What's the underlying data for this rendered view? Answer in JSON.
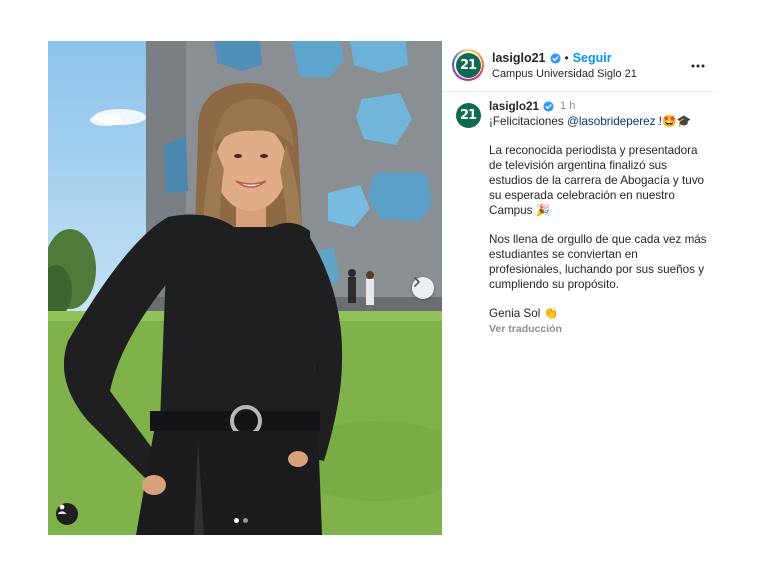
{
  "post": {
    "account": {
      "username": "lasiglo21",
      "logo_text": "21",
      "location": "Campus Universidad Siglo 21",
      "follow_label": "Seguir",
      "separator": "•"
    },
    "caption": {
      "username": "lasiglo21",
      "time": "1 h",
      "line1_prefix": "¡Felicitaciones ",
      "mention": "@lasobrideperez",
      "line1_suffix": " !🤩🎓",
      "paragraph1": "La reconocida periodista y presentadora de televisión argentina finalizó sus estudios de la carrera de Abogacía y tuvo su esperada celebración en nuestro Campus 🎉",
      "paragraph2": "Nos llena de orgullo de que cada vez más estudiantes se conviertan en profesionales, luchando por sus sueños y cumpliendo su propósito.",
      "signoff": "Genia Sol 👏",
      "translate_label": "Ver traducción"
    },
    "carousel": {
      "current": 1,
      "total": 2
    },
    "colors": {
      "brand_green": "#0f6a4f",
      "link_blue": "#0095f6",
      "mention_blue": "#00376b",
      "verified_blue": "#3897f0"
    }
  }
}
